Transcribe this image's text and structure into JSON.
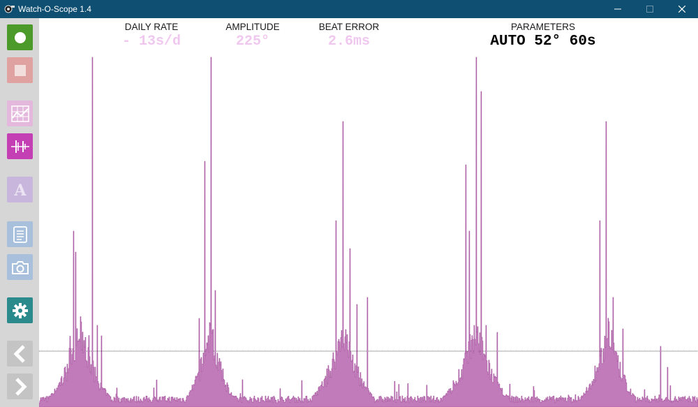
{
  "window": {
    "title": "Watch-O-Scope 1.4",
    "controls": [
      "minimize",
      "maximize",
      "close"
    ]
  },
  "toolbar": [
    {
      "name": "record-button",
      "icon": "record-circle-icon",
      "color": "#4c9a2a",
      "enabled": true
    },
    {
      "name": "stop-button",
      "icon": "stop-square-icon",
      "color": "#e0a1a1",
      "enabled": false
    },
    {
      "name": "graph-view-button",
      "icon": "chart-grid-icon",
      "color": "#e3b8dc",
      "enabled": false
    },
    {
      "name": "waveform-view-button",
      "icon": "waveform-icon",
      "color": "#c33fb3",
      "enabled": true
    },
    {
      "name": "font-button",
      "icon": "letter-a-icon",
      "color": "#c9b6dd",
      "enabled": false
    },
    {
      "name": "log-button",
      "icon": "document-list-icon",
      "color": "#a9c0dc",
      "enabled": false
    },
    {
      "name": "camera-button",
      "icon": "camera-icon",
      "color": "#a9c0dc",
      "enabled": false
    },
    {
      "name": "settings-button",
      "icon": "gear-icon",
      "color": "#2a8a8c",
      "enabled": true
    },
    {
      "name": "prev-button",
      "icon": "chevron-left-icon",
      "color": "#c4c4c4",
      "enabled": false
    },
    {
      "name": "next-button",
      "icon": "chevron-right-icon",
      "color": "#c4c4c4",
      "enabled": false
    }
  ],
  "readouts": {
    "daily_rate": {
      "label": "DAILY RATE",
      "value": "- 13s/d"
    },
    "amplitude": {
      "label": "AMPLITUDE",
      "value": "225°"
    },
    "beat_error": {
      "label": "BEAT ERROR",
      "value": "2.6ms"
    },
    "parameters": {
      "label": "PARAMETERS",
      "value": "AUTO 52° 60s"
    }
  },
  "colors": {
    "titlebar": "#0e4f72",
    "waveform_fill": "#c27bba",
    "waveform_stroke": "#a24f9a",
    "dim_text": "#f0c8ef",
    "threshold_line": "#555555"
  }
}
